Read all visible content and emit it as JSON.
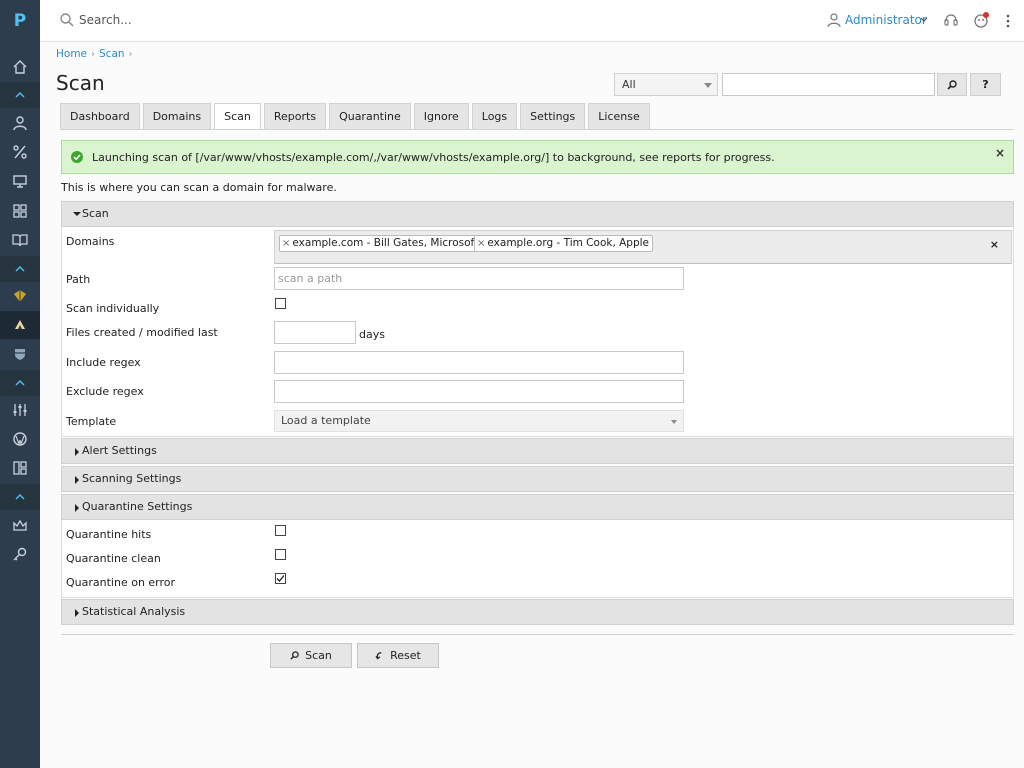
{
  "sidebar": {
    "logo": "P",
    "items": [
      {
        "name": "home-icon"
      },
      {
        "name": "user-icon"
      },
      {
        "name": "percent-icon"
      },
      {
        "name": "monitor-icon"
      },
      {
        "name": "apps-icon"
      },
      {
        "name": "book-icon"
      },
      {
        "name": "extension-a-icon"
      },
      {
        "name": "extension-b-icon"
      },
      {
        "name": "extension-c-icon"
      },
      {
        "name": "sliders-icon"
      },
      {
        "name": "wordpress-icon"
      },
      {
        "name": "layout-icon"
      },
      {
        "name": "crown-icon"
      },
      {
        "name": "key-icon"
      }
    ]
  },
  "topbar": {
    "search_placeholder": "Search...",
    "user": "Administrator"
  },
  "breadcrumb": [
    "Home",
    "Scan"
  ],
  "page_title": "Scan",
  "top_filter": {
    "select_value": "All",
    "input_value": "",
    "help_label": "?"
  },
  "tabs": [
    "Dashboard",
    "Domains",
    "Scan",
    "Reports",
    "Quarantine",
    "Ignore",
    "Logs",
    "Settings",
    "License"
  ],
  "active_tab": "Scan",
  "alert": {
    "text": "Launching scan of [/var/www/vhosts/example.com/,/var/www/vhosts/example.org/] to background, see reports for progress.",
    "close": "×",
    "color": "#d9f4cf"
  },
  "intro": "This is where you can scan a domain for malware.",
  "scan_section": {
    "title": "Scan",
    "fields": {
      "domains_label": "Domains",
      "domains": [
        "example.com - Bill Gates, Microsoft",
        "example.org - Tim Cook, Apple"
      ],
      "domains_clear": "×",
      "tag_remove": "×",
      "path_label": "Path",
      "path_placeholder": "scan a path",
      "scan_individually_label": "Scan individually",
      "scan_individually_checked": false,
      "files_modified_label": "Files created / modified last",
      "files_modified_value": "",
      "days_label": "days",
      "include_regex_label": "Include regex",
      "exclude_regex_label": "Exclude regex",
      "template_label": "Template",
      "template_value": "Load a template"
    }
  },
  "alert_settings": {
    "title": "Alert Settings"
  },
  "scanning_settings": {
    "title": "Scanning Settings"
  },
  "quarantine_settings": {
    "title": "Quarantine Settings",
    "hits_label": "Quarantine hits",
    "hits_checked": false,
    "clean_label": "Quarantine clean",
    "clean_checked": false,
    "error_label": "Quarantine on error",
    "error_checked": true
  },
  "statistical_analysis": {
    "title": "Statistical Analysis"
  },
  "actions": {
    "scan": "Scan",
    "reset": "Reset"
  },
  "colors": {
    "sidebar_bg": "#2e3d4e",
    "link": "#2d8ac7",
    "alert_bg": "#d9f4cf"
  }
}
